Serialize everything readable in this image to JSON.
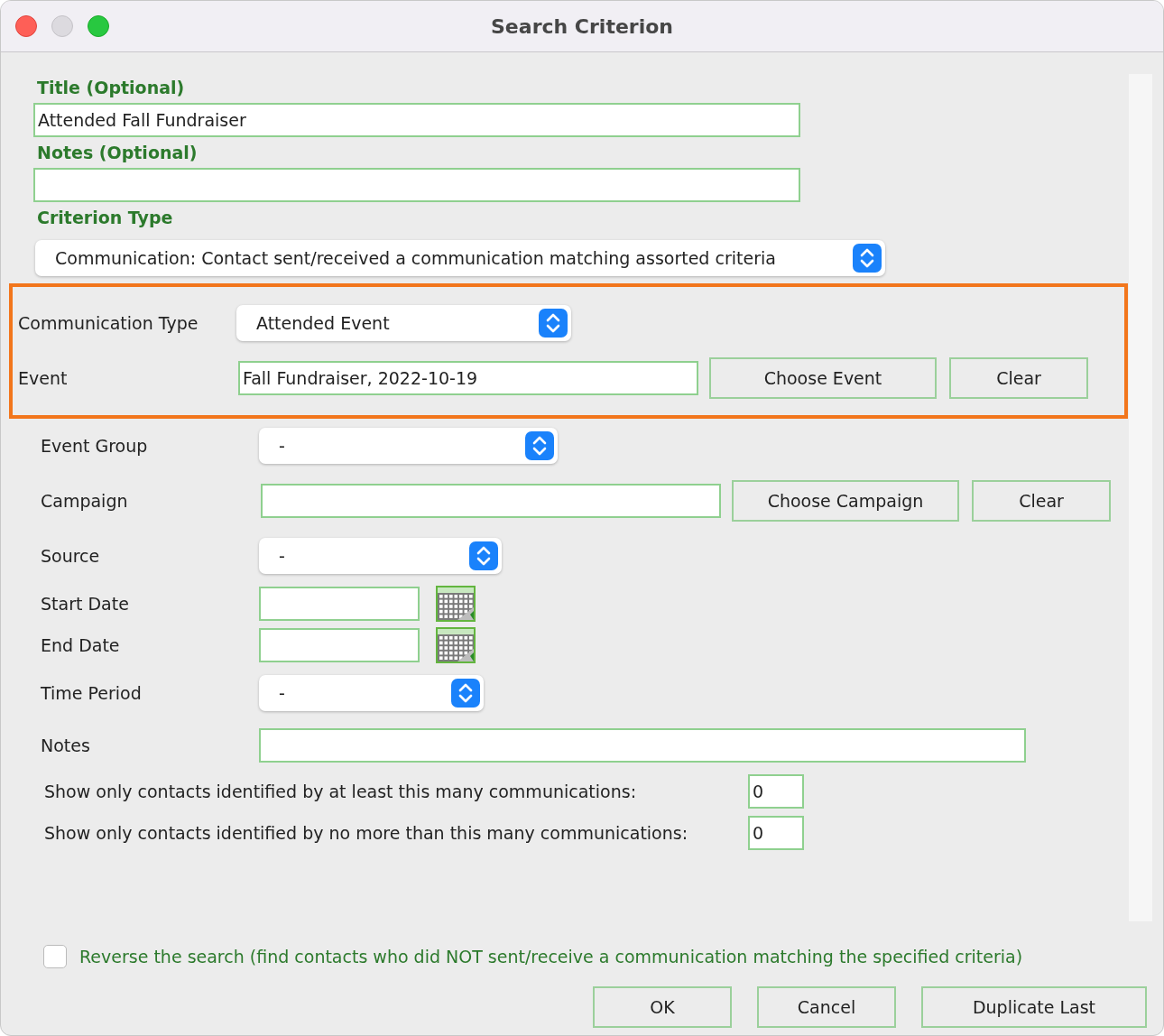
{
  "window": {
    "title": "Search Criterion"
  },
  "title_field": {
    "label": "Title (Optional)",
    "value": "Attended Fall Fundraiser"
  },
  "notes_field": {
    "label": "Notes (Optional)"
  },
  "criterion_type": {
    "label": "Criterion Type",
    "value": "Communication: Contact sent/received a communication matching assorted criteria"
  },
  "highlighted_fields": [
    {
      "kind": "select",
      "label": "Communication Type",
      "value": "Attended Event"
    },
    {
      "kind": "text_buttons",
      "label": "Event",
      "value": "Fall Fundraiser, 2022-10-19",
      "buttons": [
        "Choose Event",
        "Clear"
      ]
    }
  ],
  "fields": [
    {
      "kind": "select",
      "label": "Event Group",
      "value": "-"
    },
    {
      "kind": "text_buttons",
      "label": "Campaign",
      "buttons": [
        "Choose Campaign",
        "Clear"
      ]
    },
    {
      "kind": "select",
      "label": "Source",
      "value": "-"
    },
    {
      "kind": "date",
      "label": "Start Date"
    },
    {
      "kind": "date",
      "label": "End Date"
    },
    {
      "kind": "select",
      "label": "Time Period",
      "value": "-"
    },
    {
      "kind": "text",
      "label": "Notes"
    }
  ],
  "counts": [
    {
      "label": "Show only contacts identified by at least this many communications:",
      "value": "0"
    },
    {
      "label": "Show only contacts identified by no more than this many communications:",
      "value": "0"
    }
  ],
  "reverse": {
    "label": "Reverse the search (find contacts who did NOT sent/receive a communication matching the specified criteria)",
    "checked": false
  },
  "buttons": [
    "OK",
    "Cancel",
    "Duplicate Last"
  ]
}
